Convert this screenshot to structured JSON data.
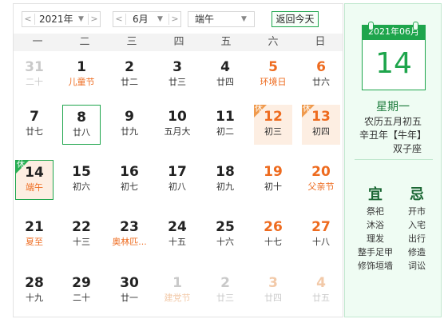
{
  "toolbar": {
    "prev_year_arrow": "<",
    "year": "2021年",
    "next_year_arrow": ">",
    "prev_month_arrow": "<",
    "month": "6月",
    "next_month_arrow": ">",
    "holiday": "端午",
    "dropdown_arrow": "▼",
    "today_button": "返回今天"
  },
  "week_header": [
    "一",
    "二",
    "三",
    "四",
    "五",
    "六",
    "日"
  ],
  "weeks": [
    [
      {
        "n": "31",
        "l": "二十",
        "dim": true
      },
      {
        "n": "1",
        "l": "儿童节",
        "fest": true
      },
      {
        "n": "2",
        "l": "廿二"
      },
      {
        "n": "3",
        "l": "廿三"
      },
      {
        "n": "4",
        "l": "廿四"
      },
      {
        "n": "5",
        "l": "环境日",
        "fest": true,
        "wk": true
      },
      {
        "n": "6",
        "l": "廿六",
        "wk": true
      }
    ],
    [
      {
        "n": "7",
        "l": "廿七"
      },
      {
        "n": "8",
        "l": "廿八",
        "hl": true
      },
      {
        "n": "9",
        "l": "廿九"
      },
      {
        "n": "10",
        "l": "五月大"
      },
      {
        "n": "11",
        "l": "初二"
      },
      {
        "n": "12",
        "l": "初三",
        "wk": true,
        "rest": true
      },
      {
        "n": "13",
        "l": "初四",
        "wk": true,
        "rest": true
      }
    ],
    [
      {
        "n": "14",
        "l": "端午",
        "fest": true,
        "today": true
      },
      {
        "n": "15",
        "l": "初六"
      },
      {
        "n": "16",
        "l": "初七"
      },
      {
        "n": "17",
        "l": "初八"
      },
      {
        "n": "18",
        "l": "初九"
      },
      {
        "n": "19",
        "l": "初十",
        "wk": true
      },
      {
        "n": "20",
        "l": "父亲节",
        "fest": true,
        "wk": true
      }
    ],
    [
      {
        "n": "21",
        "l": "夏至",
        "fest": true
      },
      {
        "n": "22",
        "l": "十三"
      },
      {
        "n": "23",
        "l": "奥林匹...",
        "fest": true
      },
      {
        "n": "24",
        "l": "十五"
      },
      {
        "n": "25",
        "l": "十六"
      },
      {
        "n": "26",
        "l": "十七",
        "wk": true
      },
      {
        "n": "27",
        "l": "十八",
        "wk": true
      }
    ],
    [
      {
        "n": "28",
        "l": "十九"
      },
      {
        "n": "29",
        "l": "二十"
      },
      {
        "n": "30",
        "l": "廿一"
      },
      {
        "n": "1",
        "l": "建党节",
        "dim": true,
        "fest": true
      },
      {
        "n": "2",
        "l": "廿三",
        "dim": true
      },
      {
        "n": "3",
        "l": "廿四",
        "dim": true,
        "wk": true
      },
      {
        "n": "4",
        "l": "廿五",
        "dim": true,
        "wk": true
      }
    ]
  ],
  "rest_tag": "休",
  "panel": {
    "header": "2021年06月",
    "day": "14",
    "weekday": "星期一",
    "lunar": "农历五月初五",
    "ganzhi": "辛丑年【牛年】",
    "constellation": "双子座",
    "yi_title": "宜",
    "ji_title": "忌",
    "yi": [
      "祭祀",
      "沐浴",
      "理发",
      "整手足甲",
      "修饰垣墙"
    ],
    "ji": [
      "开市",
      "入宅",
      "出行",
      "修造",
      "词讼"
    ]
  },
  "colors": {
    "green": "#1ea54c",
    "orange": "#ee6b1f",
    "rest_bg": "#fdeee2"
  }
}
